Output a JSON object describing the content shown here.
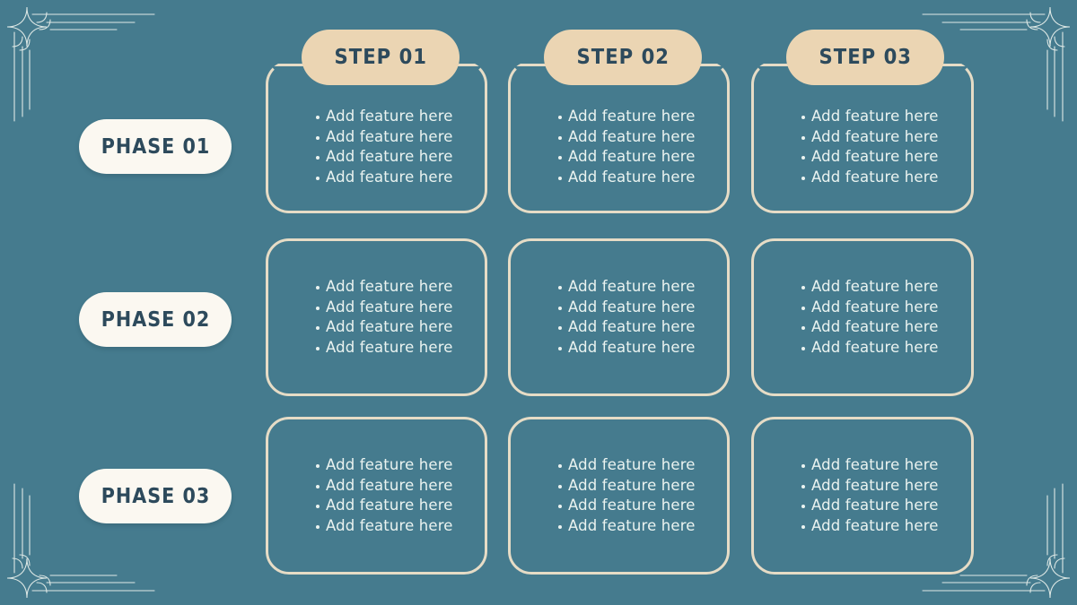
{
  "slide": {
    "background_color": "#457b8e",
    "accent_tan": "#ebd5b3",
    "card_border_color": "#e6dcc6",
    "pill_white": "#fbf8f1",
    "heading_text_color": "#2d4a5c",
    "body_text_color": "#eaf3f0"
  },
  "phases": [
    {
      "label": "PHASE 01"
    },
    {
      "label": "PHASE 02"
    },
    {
      "label": "PHASE 03"
    }
  ],
  "steps": [
    {
      "label": "STEP 01"
    },
    {
      "label": "STEP 02"
    },
    {
      "label": "STEP 03"
    }
  ],
  "cards": [
    {
      "row": 1,
      "col": 1,
      "bullets": [
        "Add feature here",
        "Add feature here",
        "Add feature here",
        "Add feature here"
      ]
    },
    {
      "row": 1,
      "col": 2,
      "bullets": [
        "Add feature here",
        "Add feature here",
        "Add feature here",
        "Add feature here"
      ]
    },
    {
      "row": 1,
      "col": 3,
      "bullets": [
        "Add feature here",
        "Add feature here",
        "Add feature here",
        "Add feature here"
      ]
    },
    {
      "row": 2,
      "col": 1,
      "bullets": [
        "Add feature here",
        "Add feature here",
        "Add feature here",
        "Add feature here"
      ]
    },
    {
      "row": 2,
      "col": 2,
      "bullets": [
        "Add feature here",
        "Add feature here",
        "Add feature here",
        "Add feature here"
      ]
    },
    {
      "row": 2,
      "col": 3,
      "bullets": [
        "Add feature here",
        "Add feature here",
        "Add feature here",
        "Add feature here"
      ]
    },
    {
      "row": 3,
      "col": 1,
      "bullets": [
        "Add feature here",
        "Add feature here",
        "Add feature here",
        "Add feature here"
      ]
    },
    {
      "row": 3,
      "col": 2,
      "bullets": [
        "Add feature here",
        "Add feature here",
        "Add feature here",
        "Add feature here"
      ]
    },
    {
      "row": 3,
      "col": 3,
      "bullets": [
        "Add feature here",
        "Add feature here",
        "Add feature here",
        "Add feature here"
      ]
    }
  ],
  "ornaments": {
    "top_left": "corner-flourish-ornament",
    "top_right": "corner-flourish-ornament",
    "bottom_left": "corner-flourish-ornament",
    "bottom_right": "corner-flourish-ornament"
  }
}
